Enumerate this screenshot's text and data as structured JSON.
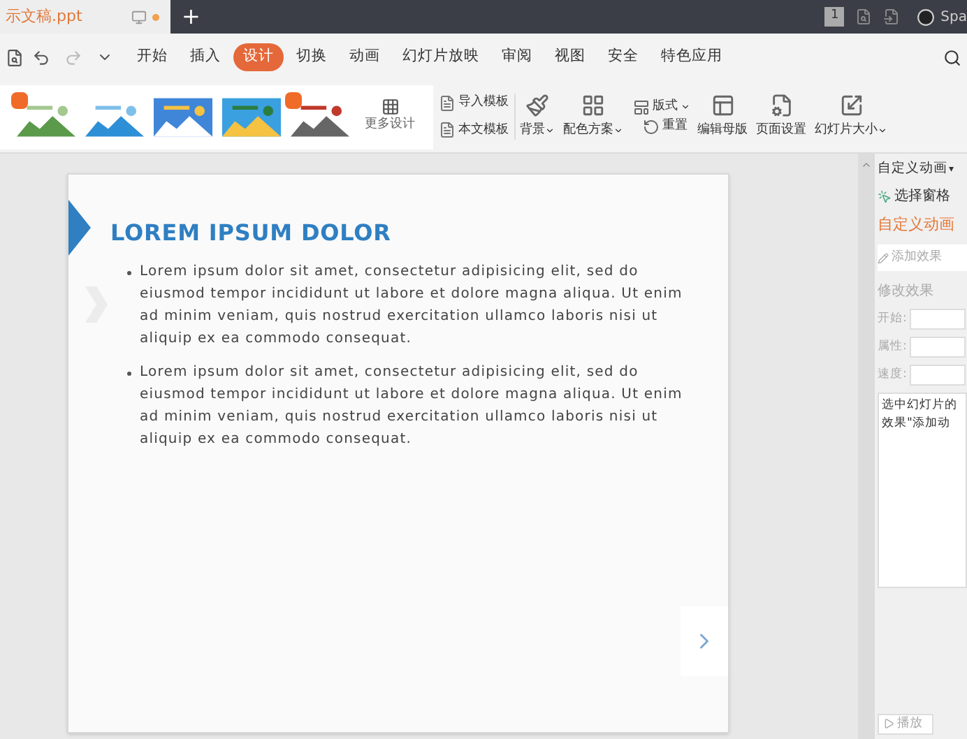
{
  "document_tab": {
    "title": "示文稿.ppt",
    "unsaved": true
  },
  "titlebar": {
    "new_tab": "+",
    "badge": "1",
    "user": "Spa"
  },
  "menu": [
    {
      "label": "开始",
      "selected": false
    },
    {
      "label": "插入",
      "selected": false
    },
    {
      "label": "设计",
      "selected": true
    },
    {
      "label": "切换",
      "selected": false
    },
    {
      "label": "动画",
      "selected": false
    },
    {
      "label": "幻灯片放映",
      "selected": false
    },
    {
      "label": "审阅",
      "selected": false
    },
    {
      "label": "视图",
      "selected": false
    },
    {
      "label": "安全",
      "selected": false
    },
    {
      "label": "特色应用",
      "selected": false
    }
  ],
  "templates": [
    {
      "kind": "picture",
      "premium": true
    },
    {
      "kind": "picture",
      "premium": false
    },
    {
      "kind": "picture",
      "premium": false
    },
    {
      "kind": "picture",
      "premium": false
    },
    {
      "kind": "picture",
      "premium": true
    }
  ],
  "more_designs": "更多设计",
  "template_buttons": [
    "导入模板",
    "本文模板"
  ],
  "ribbon_buttons": [
    {
      "label": "背景",
      "dropdown": true,
      "kind": "large"
    },
    {
      "label": "配色方案",
      "dropdown": true,
      "kind": "large"
    },
    {
      "label": "版式",
      "dropdown": true,
      "kind": "small"
    },
    {
      "label": "重置",
      "dropdown": false,
      "kind": "small"
    },
    {
      "label": "编辑母版",
      "dropdown": false,
      "kind": "large"
    },
    {
      "label": "页面设置",
      "dropdown": false,
      "kind": "large"
    },
    {
      "label": "幻灯片大小",
      "dropdown": true,
      "kind": "large"
    }
  ],
  "slide": {
    "title": "LOREM IPSUM DOLOR",
    "bullets": [
      "Lorem ipsum dolor sit amet, consectetur adipisicing elit, sed do eiusmod tempor incididunt ut labore et dolore magna aliqua. Ut enim ad minim veniam, quis nostrud exercitation ullamco laboris nisi ut aliquip ex ea commodo consequat.",
      "Lorem ipsum dolor sit amet, consectetur adipisicing elit, sed do eiusmod tempor incididunt ut labore et dolore magna aliqua. Ut enim ad minim veniam, quis nostrud exercitation ullamco laboris nisi ut aliquip ex ea commodo consequat."
    ]
  },
  "panel": {
    "header": "自定义动画",
    "header_caret": "▾",
    "select_pane": "选择窗格",
    "title": "自定义动画",
    "add_effect": "添加效果",
    "modify": "修改效果",
    "fields": [
      {
        "label": "开始:"
      },
      {
        "label": "属性:"
      },
      {
        "label": "速度:"
      }
    ],
    "hint": [
      "选中幻灯片的",
      "效果\"添加动"
    ],
    "play": "播放"
  }
}
